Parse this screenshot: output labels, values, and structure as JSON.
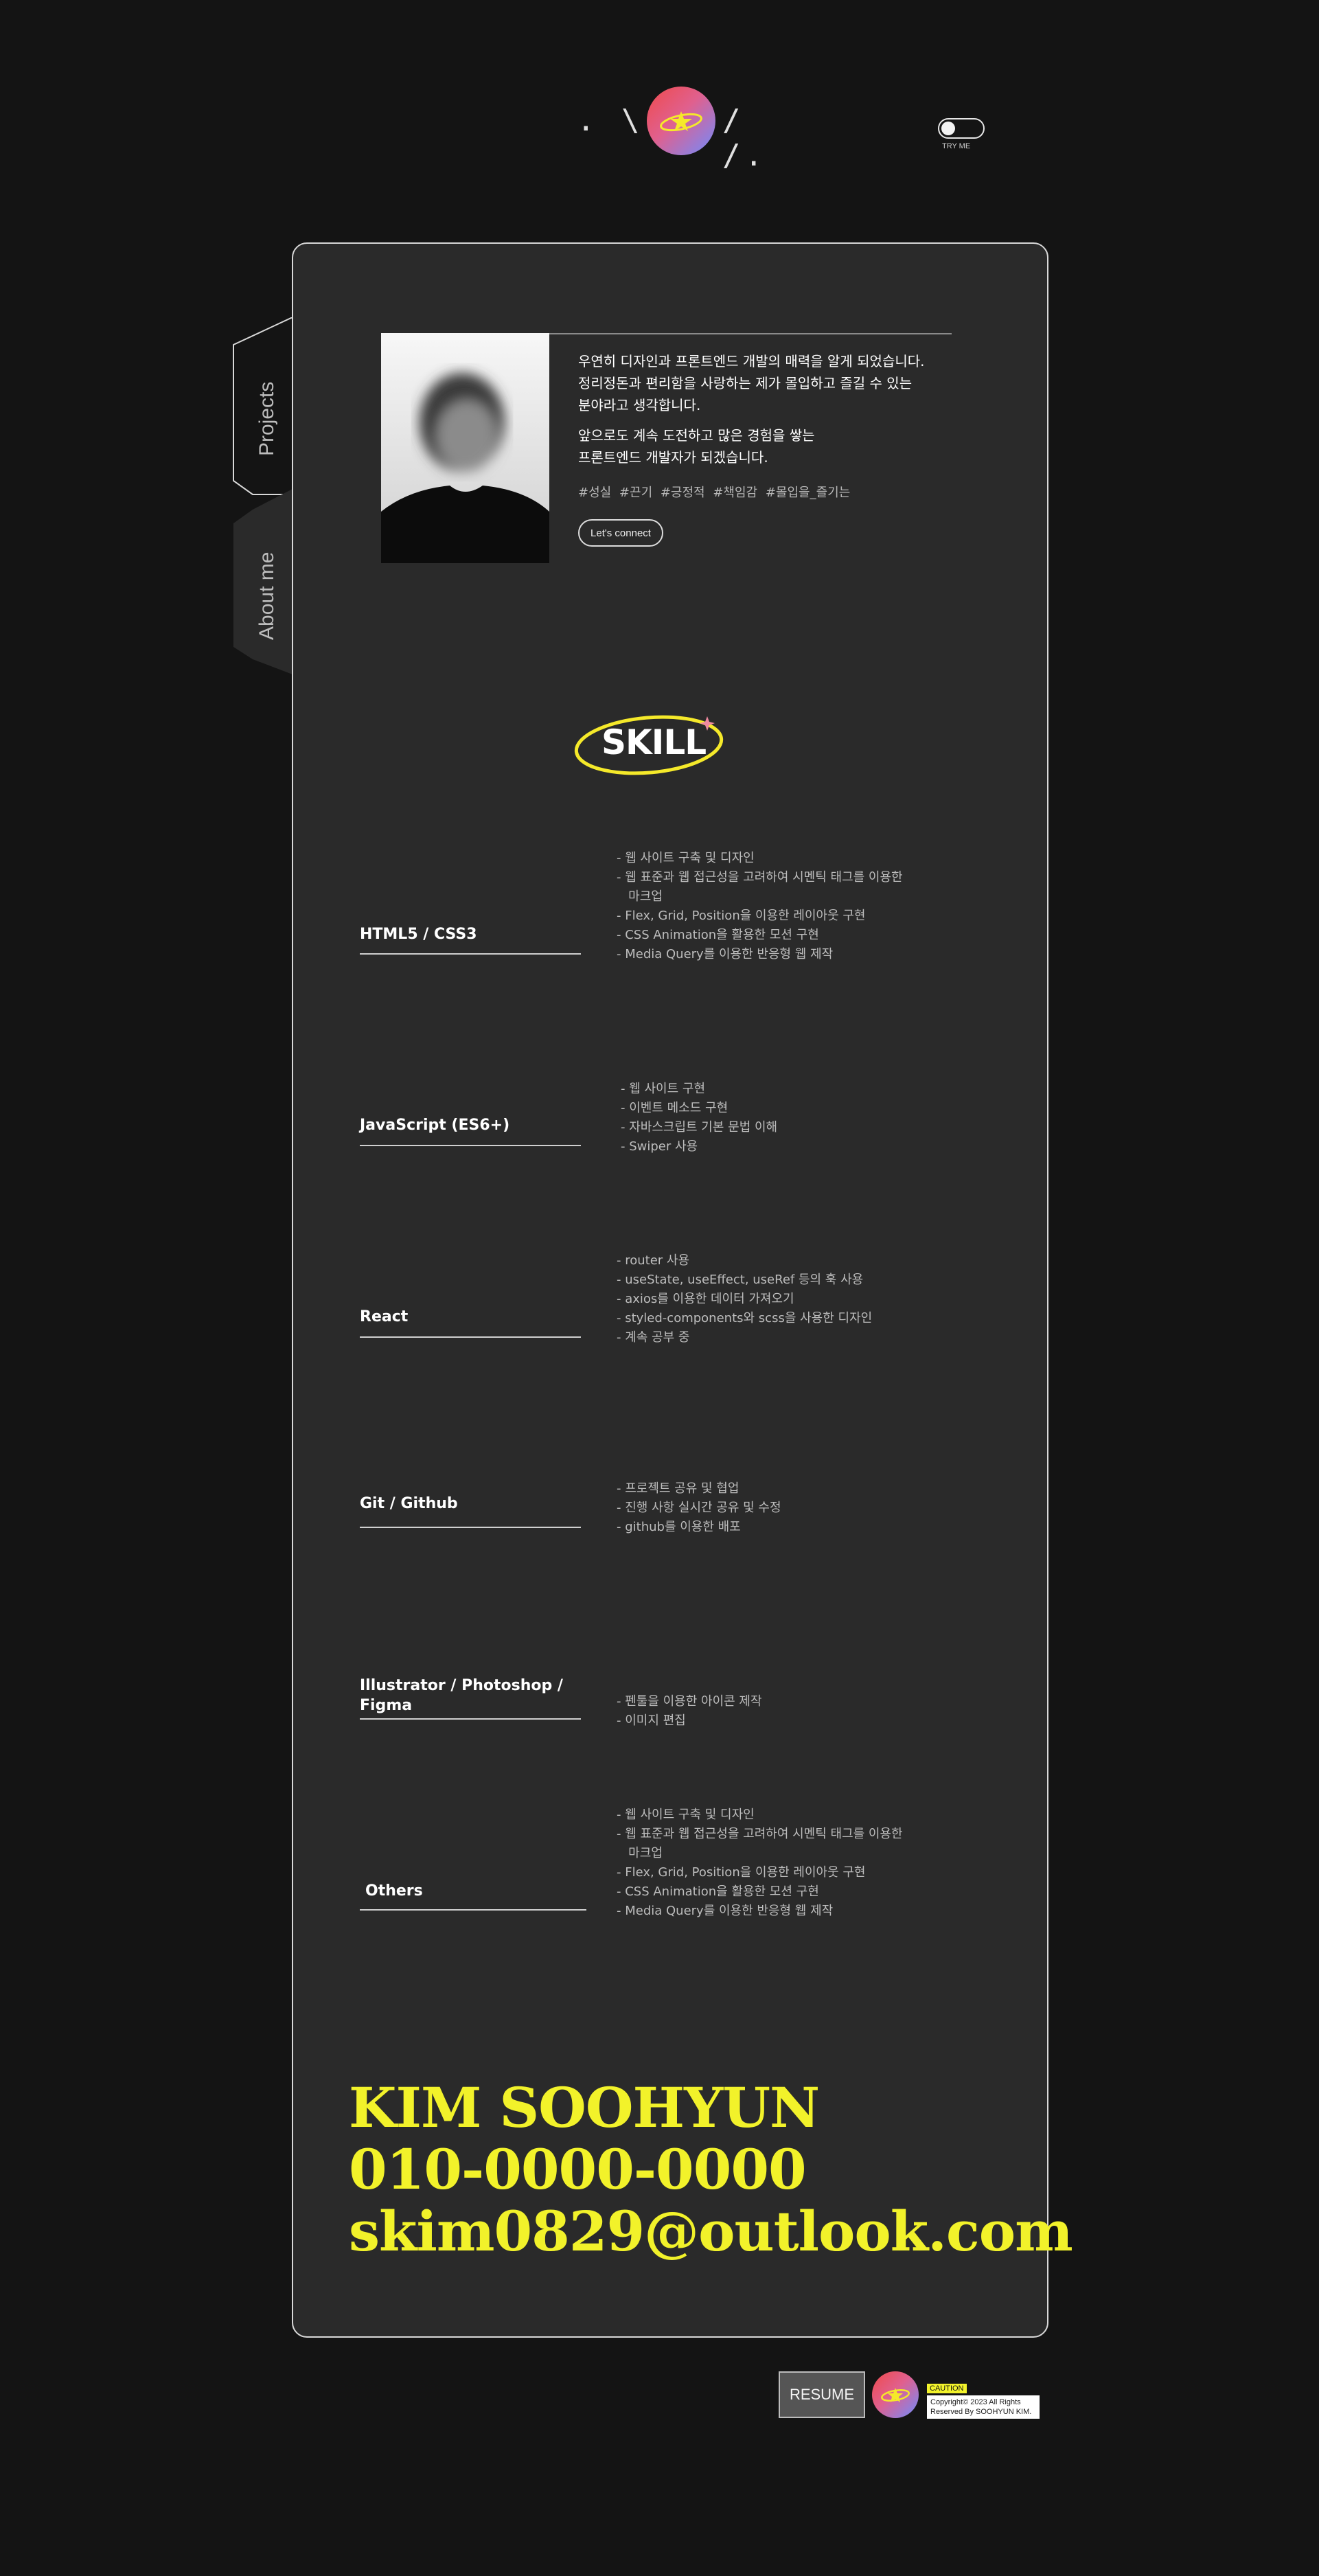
{
  "header": {
    "left_deco": ". \\ \\",
    "right_deco": "/ /.",
    "toggle_label": "TRY ME"
  },
  "tabs": [
    {
      "label": "Projects"
    },
    {
      "label": "About me"
    }
  ],
  "about": {
    "para1": [
      "우연히 디자인과 프론트엔드 개발의 매력을 알게 되었습니다.",
      "정리정돈과 편리함을 사랑하는 제가 몰입하고 즐길  수 있는",
      "분야라고 생각합니다."
    ],
    "para2": [
      "앞으로도 계속 도전하고 많은 경험을 쌓는",
      "프론트엔드 개발자가 되겠습니다."
    ],
    "hashtags": "#성실  #끈기  #긍정적  #책임감  #몰입을_즐기는",
    "connect_label": "Let's connect"
  },
  "skill": {
    "title": "SKILL",
    "groups": [
      {
        "name": "HTML5 / CSS3",
        "items": [
          "- 웹 사이트 구축 및 디자인",
          "- 웹 표준과 웹 접근성을 고려하여 시멘틱 태그를 이용한",
          "   마크업",
          "- Flex, Grid, Position을 이용한 레이아웃 구현",
          "- CSS Animation을 활용한 모션 구현",
          "- Media Query를 이용한 반응형 웹 제작"
        ]
      },
      {
        "name": "JavaScript (ES6+)",
        "items": [
          "- 웹 사이트 구현",
          "- 이벤트 메소드 구현",
          "- 자바스크립트 기본 문법 이해",
          "- Swiper 사용"
        ]
      },
      {
        "name": "React",
        "items": [
          "- router 사용",
          "- useState, useEffect, useRef 등의 훅 사용",
          "- axios를 이용한 데이터 가져오기",
          "- styled-components와 scss을 사용한 디자인",
          "- 계속 공부 중"
        ]
      },
      {
        "name": "Git / Github",
        "items": [
          "- 프로젝트 공유 및 협업",
          "- 진행 사항 실시간 공유 및 수정",
          "- github를 이용한 배포"
        ]
      },
      {
        "name": "Illustrator / Photoshop /\nFigma",
        "items": [
          "- 펜툴을 이용한 아이콘 제작",
          "- 이미지 편집"
        ]
      },
      {
        "name": "Others",
        "items": [
          "- 웹 사이트 구축 및 디자인",
          "- 웹 표준과 웹 접근성을 고려하여 시멘틱 태그를 이용한",
          "   마크업",
          "- Flex, Grid, Position을 이용한 레이아웃 구현",
          "- CSS Animation을 활용한 모션 구현",
          "- Media Query를 이용한 반응형 웹 제작"
        ]
      }
    ]
  },
  "contact": {
    "name": "KIM SOOHYUN",
    "phone": "010-0000-0000",
    "email": "skim0829@outlook.com"
  },
  "footer": {
    "resume_label": "RESUME",
    "caution_label": "CAUTION",
    "copyright_line1": "Copyright© 2023 All Rights",
    "copyright_line2": "Reserved By SOOHYUN KIM."
  },
  "colors": {
    "background": "#141414",
    "card": "#2a2a2a",
    "accent_yellow": "#f2f22a",
    "gradient_red": "#f04a4a",
    "gradient_blue": "#6f8cff"
  }
}
